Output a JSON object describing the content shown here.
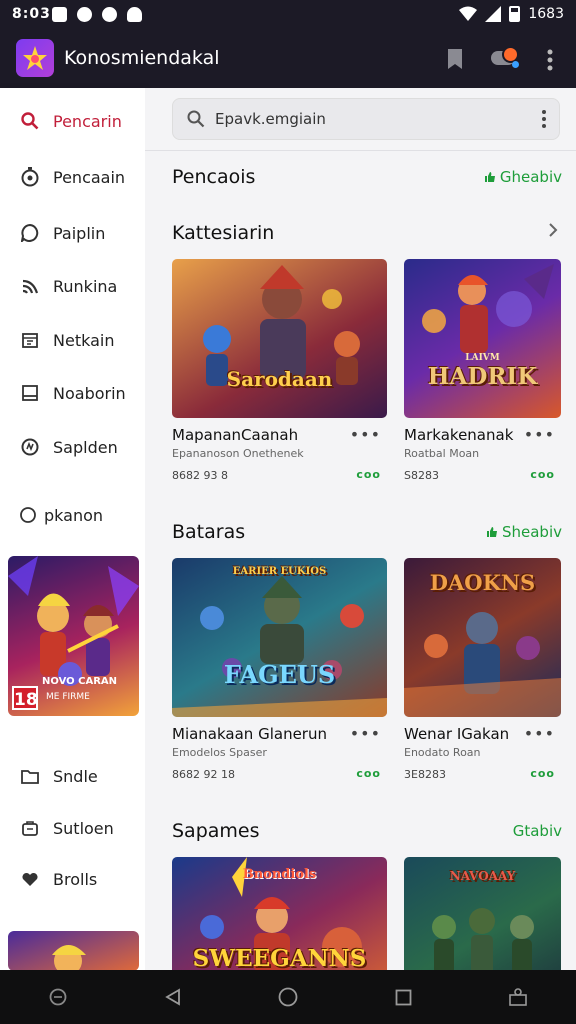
{
  "status": {
    "time": "8:03",
    "right_text": "1683"
  },
  "app": {
    "title": "Konosmiendakal"
  },
  "drawer": {
    "items": [
      {
        "label": "Pencarin",
        "icon": "search-icon",
        "active": true
      },
      {
        "label": "Pencaain",
        "icon": "timer-icon"
      },
      {
        "label": "Paiplin",
        "icon": "chat-bubble-icon"
      },
      {
        "label": "Runkina",
        "icon": "signal-icon"
      },
      {
        "label": "Netkain",
        "icon": "calendar-icon"
      },
      {
        "label": "Noaborin",
        "icon": "window-icon"
      },
      {
        "label": "Saplden",
        "icon": "badge-icon"
      },
      {
        "label": "pkanon",
        "icon": "circle-icon"
      }
    ],
    "banner_badge": "18",
    "banner_title": "NOVO CARAN",
    "banner_subtitle": "ME FIRME",
    "bottom_items": [
      {
        "label": "Sndle",
        "icon": "folder-icon"
      },
      {
        "label": "Sutloen",
        "icon": "bag-icon"
      },
      {
        "label": "Brolls",
        "icon": "heart-icon"
      }
    ]
  },
  "search": {
    "placeholder": "Epavk.emgiain"
  },
  "sections": [
    {
      "title": "Pencaois",
      "link": "Gheabiv"
    },
    {
      "title": "Kattesiarin"
    },
    {
      "title": "Bataras",
      "link": "Sheabiv"
    },
    {
      "title": "Sapames",
      "link": "Gtabiv"
    }
  ],
  "cards": [
    {
      "name": "MapananCaanah",
      "sub": "Epananoson Onethenek",
      "meta": "8682 93 8",
      "art": "Sarodaan",
      "green": "coo"
    },
    {
      "name": "Markakenanak",
      "sub": "Roatbal Moan",
      "meta": "S8283",
      "art": "HADRIK",
      "art_top": "LAIVM",
      "green": "coo"
    },
    {
      "name": "Mianakaan Glanerun",
      "sub": "Emodelos Spaser",
      "meta": "8682 92 18",
      "art": "FAGEUS",
      "art_top": "EARIER EUKIOS",
      "green": "coo"
    },
    {
      "name": "Wenar IGakan",
      "sub": "Enodato Roan",
      "meta": "3E8283",
      "art": "DAOKNS",
      "green": "coo"
    },
    {
      "art": "SWEEGANNS",
      "art_top": "Bnondiols"
    },
    {
      "art_top": "NAVOAAY"
    }
  ],
  "colors": {
    "accent": "#c11f3a",
    "green": "#1e9d3a",
    "appbar": "#1c1a26"
  }
}
